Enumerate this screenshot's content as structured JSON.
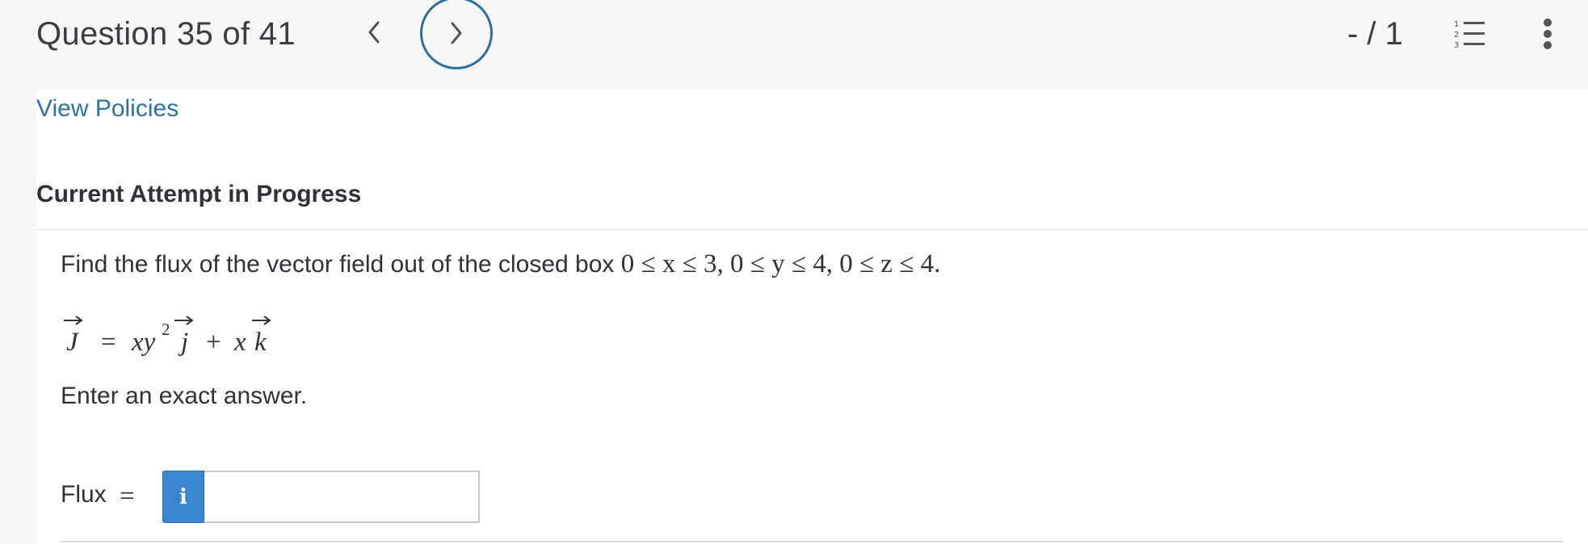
{
  "header": {
    "question_title": "Question 35 of 41",
    "score": "- / 1",
    "icons": {
      "prev": "chevron-left-icon",
      "next": "chevron-right-icon",
      "list": "numbered-list-icon",
      "more": "more-vertical-icon"
    },
    "list_icon_digits": [
      "1",
      "2",
      "3"
    ]
  },
  "links": {
    "view_policies": "View Policies"
  },
  "attempt": {
    "heading": "Current Attempt in Progress"
  },
  "question": {
    "prompt_text": "Find the flux of the vector field out of the closed box",
    "box_bounds": "0 ≤ x ≤ 3, 0 ≤ y ≤ 4, 0 ≤ z ≤ 4.",
    "equation": {
      "lhs": "J",
      "equals": "=",
      "term1_vars": "xy",
      "term1_exponent": "2",
      "term1_unit": "j",
      "plus": "+",
      "term2_var": "x",
      "term2_unit": "k"
    },
    "instruction": "Enter an exact answer."
  },
  "answer": {
    "label": "Flux",
    "equals": "=",
    "info_glyph": "i",
    "value": "",
    "placeholder": ""
  },
  "colors": {
    "accent_blue": "#2d72a8",
    "info_button": "#3a85d0",
    "next_ring": "#2d6fa1",
    "header_bg": "#f7f7f7",
    "panel_bg": "#ffffff"
  }
}
